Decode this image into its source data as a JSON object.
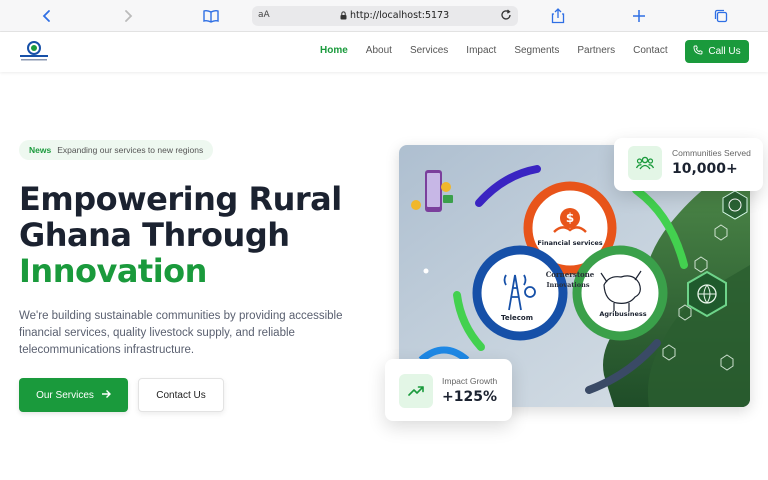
{
  "browser": {
    "url": "http://localhost:5173",
    "text_size_label": "aA"
  },
  "nav": {
    "links": [
      "Home",
      "About",
      "Services",
      "Impact",
      "Segments",
      "Partners",
      "Contact"
    ],
    "active": "Home",
    "cta_label": "Call Us"
  },
  "hero": {
    "badge_tag": "News",
    "badge_text": "Expanding our services to new regions",
    "headline_line1": "Empowering Rural",
    "headline_line2": "Ghana Through",
    "headline_accent": "Innovation",
    "description": "We're building sustainable communities by providing accessible financial services, quality livestock supply, and reliable telecommunications infrastructure.",
    "primary_button": "Our Services",
    "secondary_button": "Contact Us"
  },
  "illustration": {
    "center_label_1": "Cornerstone",
    "center_label_2": "Innovations",
    "segment_financial": "Financial services",
    "segment_telecom": "Telecom",
    "segment_agri": "Agribusiness"
  },
  "stats": [
    {
      "label": "Communities Served",
      "value": "10,000+",
      "icon": "users-icon"
    },
    {
      "label": "Impact Growth",
      "value": "+125%",
      "icon": "trending-up-icon"
    }
  ],
  "colors": {
    "brand_green": "#1a9a3c",
    "heading_dark": "#1b2230",
    "financial_orange": "#e8541a",
    "telecom_blue": "#1650a8"
  }
}
